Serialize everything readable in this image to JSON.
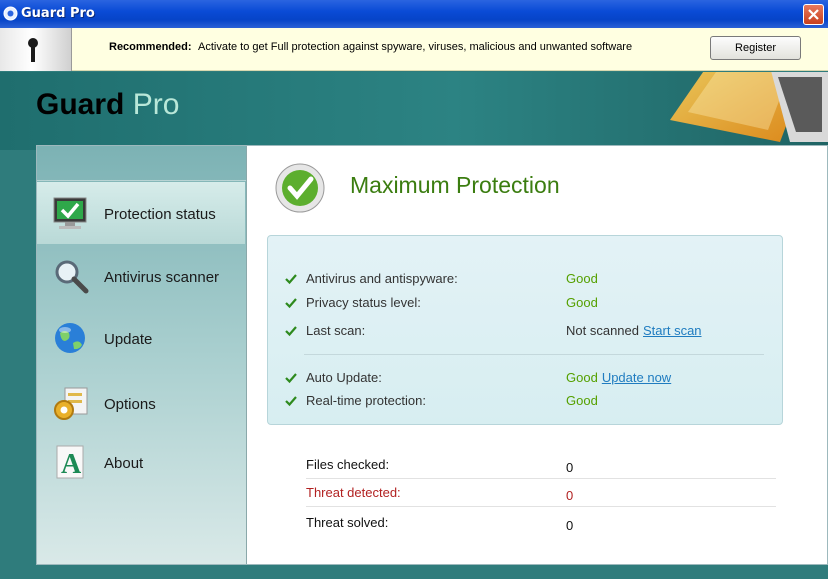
{
  "window": {
    "title": "Guard Pro",
    "accent": "#0a4bd6"
  },
  "notification": {
    "label": "Recommended:",
    "text": "Activate to get Full protection against spyware, viruses, malicious and unwanted software",
    "register_label": "Register"
  },
  "brand": {
    "word1": "Guard",
    "word2": "Pro"
  },
  "sidebar": {
    "items": [
      {
        "label": "Protection status",
        "icon": "monitor-check-icon",
        "active": true
      },
      {
        "label": "Antivirus scanner",
        "icon": "magnifier-icon",
        "active": false
      },
      {
        "label": "Update",
        "icon": "globe-icon",
        "active": false
      },
      {
        "label": "Options",
        "icon": "gear-options-icon",
        "active": false
      },
      {
        "label": "About",
        "icon": "about-a-icon",
        "active": false
      }
    ]
  },
  "main": {
    "heading": "Maximum Protection",
    "status_rows": [
      {
        "label": "Antivirus and antispyware:",
        "value": "Good"
      },
      {
        "label": "Privacy status level:",
        "value": "Good"
      },
      {
        "label": "Last scan:",
        "value": "Not scanned",
        "link": "Start scan"
      },
      {
        "label": "Auto Update:",
        "value": "Good",
        "link": "Update now"
      },
      {
        "label": "Real-time protection:",
        "value": "Good"
      }
    ],
    "stats": [
      {
        "label": "Files checked:",
        "value": "0"
      },
      {
        "label": "Threat detected:",
        "value": "0"
      },
      {
        "label": "Threat solved:",
        "value": "0"
      }
    ]
  },
  "colors": {
    "good": "#55a000",
    "link": "#1f7cc0",
    "threat": "#b22222",
    "heading": "#3b7d10"
  }
}
